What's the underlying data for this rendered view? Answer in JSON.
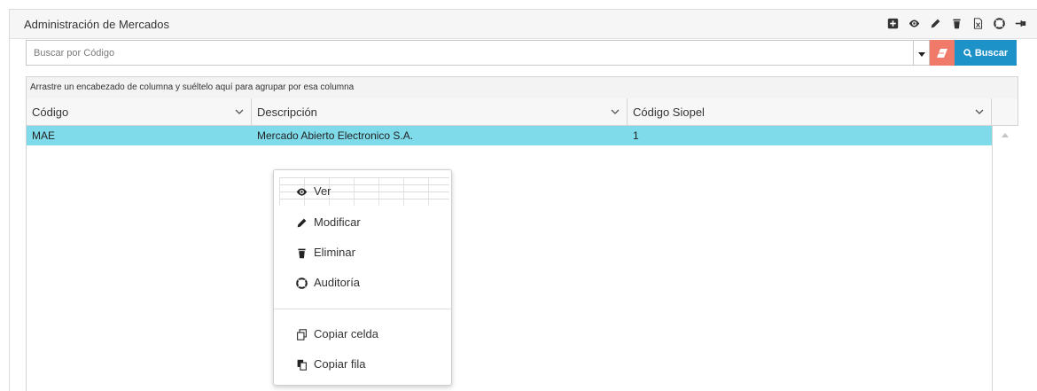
{
  "panel": {
    "title": "Administración de Mercados",
    "tools": [
      "plus-square-icon",
      "eye-icon",
      "pencil-icon",
      "trash-icon",
      "excel-icon",
      "lifebuoy-icon",
      "pin-icon"
    ]
  },
  "search": {
    "placeholder": "Buscar por Código",
    "value": "",
    "buscar_label": "Buscar"
  },
  "grid": {
    "group_hint": "Arrastre un encabezado de columna y suéltelo aquí para agrupar por esa columna",
    "columns": [
      "Código",
      "Descripción",
      "Código Siopel"
    ],
    "rows": [
      {
        "codigo": "MAE",
        "descripcion": "Mercado Abierto Electronico S.A.",
        "codigo_siopel": "1"
      }
    ],
    "selected_row_color": "#7fdbea"
  },
  "context_menu": {
    "items": [
      {
        "label": "Ver",
        "icon": "eye-icon"
      },
      {
        "label": "Modificar",
        "icon": "pencil-icon"
      },
      {
        "label": "Eliminar",
        "icon": "trash-icon"
      },
      {
        "label": "Auditoría",
        "icon": "lifebuoy-icon"
      },
      {
        "label": "Copiar celda",
        "icon": "copy-cell-icon"
      },
      {
        "label": "Copiar fila",
        "icon": "copy-row-icon"
      }
    ]
  },
  "colors": {
    "accent": "#1d92c9",
    "eraser": "#f07a6a"
  }
}
